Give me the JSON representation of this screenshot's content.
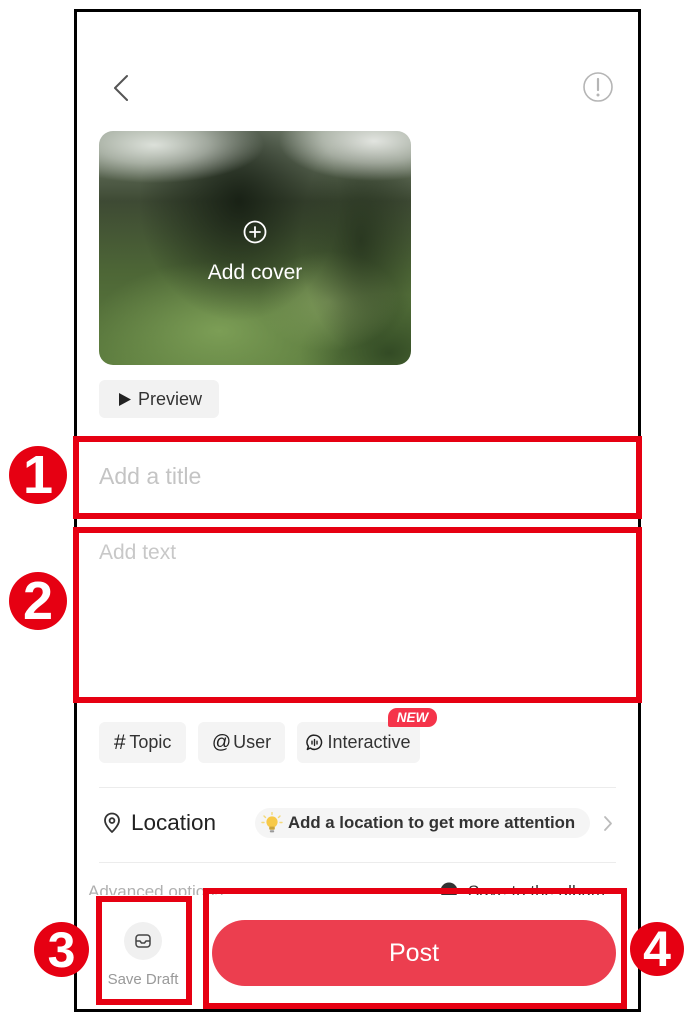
{
  "colors": {
    "accent": "#ec3e4f",
    "annotation": "#e60012",
    "new_badge": "#f5344a"
  },
  "header": {
    "back_icon": "chevron-left-icon",
    "info_icon": "exclamation-circle-icon"
  },
  "cover": {
    "add_icon": "plus-circle-icon",
    "label": "Add cover"
  },
  "preview_button": {
    "icon": "play-icon",
    "label": "Preview"
  },
  "title_input": {
    "placeholder": "Add a title",
    "value": ""
  },
  "text_input": {
    "placeholder": "Add text",
    "value": ""
  },
  "chips": [
    {
      "glyph": "#",
      "label": "Topic"
    },
    {
      "glyph": "@",
      "label": "User"
    },
    {
      "icon": "interactive-bubble-icon",
      "label": "Interactive",
      "badge": "NEW"
    }
  ],
  "location": {
    "icon": "location-pin-icon",
    "label": "Location",
    "hint_icon": "lightbulb-icon",
    "hint": "Add a location to get more attention",
    "chevron_icon": "chevron-right-icon"
  },
  "options": {
    "advanced_label": "Advanced options",
    "album_icon": "radio-circle-icon",
    "album_label": "Save to the album"
  },
  "bottom_bar": {
    "save_draft_icon": "draft-box-icon",
    "save_draft_label": "Save Draft",
    "post_label": "Post"
  },
  "annotations": [
    {
      "number": "1"
    },
    {
      "number": "2"
    },
    {
      "number": "3"
    },
    {
      "number": "4"
    }
  ]
}
